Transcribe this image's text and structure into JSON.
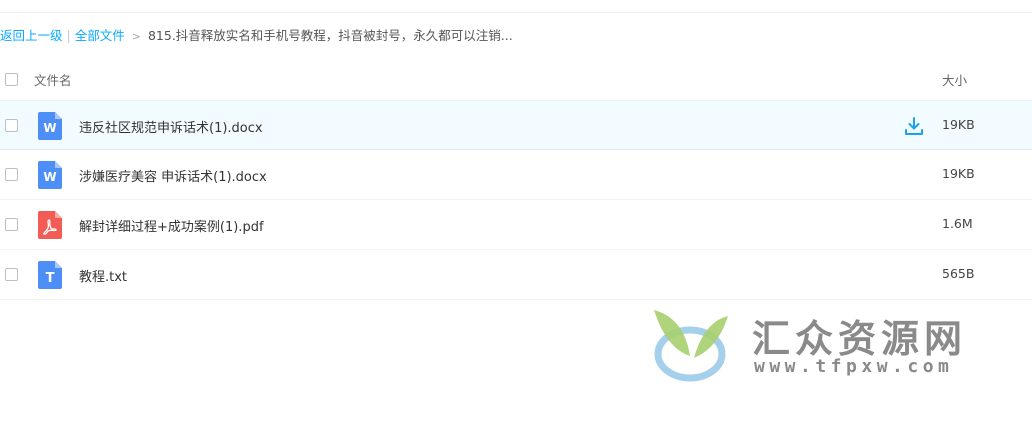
{
  "breadcrumb": {
    "back": "返回上一级",
    "separator": "|",
    "all_files": "全部文件",
    "arrow": ">",
    "current": "815.抖音释放实名和手机号教程，抖音被封号，永久都可以注销..."
  },
  "table": {
    "header_name": "文件名",
    "header_size": "大小",
    "rows": [
      {
        "name": "违反社区规范申诉话术(1).docx",
        "size": "19KB",
        "type": "docx",
        "icon_letter": "W"
      },
      {
        "name": "涉嫌医疗美容 申诉话术(1).docx",
        "size": "19KB",
        "type": "docx",
        "icon_letter": "W"
      },
      {
        "name": "解封详细过程+成功案例(1).pdf",
        "size": "1.6M",
        "type": "pdf"
      },
      {
        "name": "教程.txt",
        "size": "565B",
        "type": "txt",
        "icon_letter": "T"
      }
    ]
  },
  "watermark": {
    "title": "汇众资源网",
    "url": "www.tfpxw.com"
  },
  "colors": {
    "link": "#09aaff",
    "word_icon": "#4d8ef7",
    "pdf_icon": "#f25c54",
    "txt_icon": "#4d8ef7",
    "download": "#1aa3e8",
    "hover_row": "#f2fbff"
  }
}
